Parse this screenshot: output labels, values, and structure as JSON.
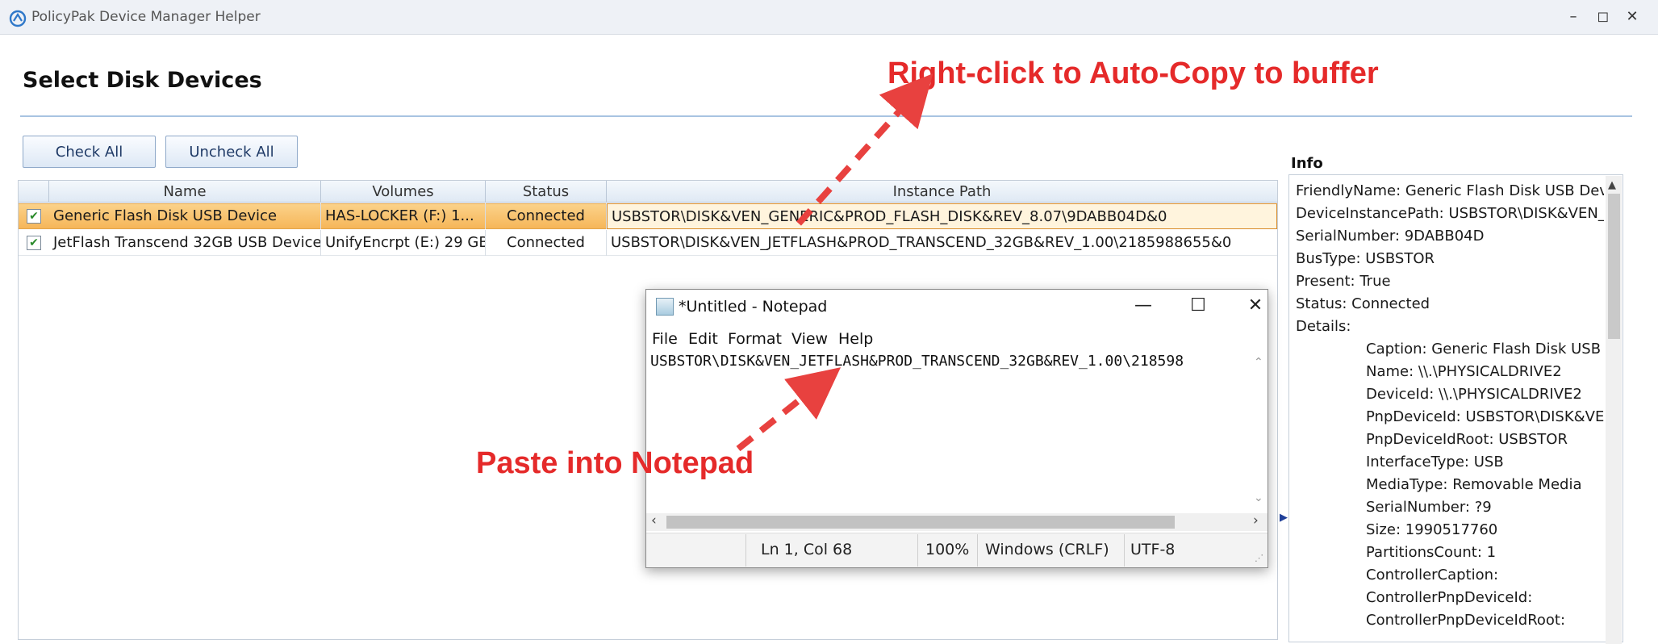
{
  "window": {
    "title": "PolicyPak Device Manager Helper",
    "minimize": "–",
    "maximize": "◻",
    "close": "✕"
  },
  "page_title": "Select Disk Devices",
  "toolbar": {
    "check_all": "Check All",
    "uncheck_all": "Uncheck All"
  },
  "grid": {
    "columns": [
      "Name",
      "Volumes",
      "Status",
      "Instance Path"
    ],
    "rows": [
      {
        "checked": true,
        "name": "Generic Flash Disk USB Device",
        "volumes": "HAS-LOCKER (F:) 1...",
        "status": "Connected",
        "path": "USBSTOR\\DISK&VEN_GENERIC&PROD_FLASH_DISK&REV_8.07\\9DABB04D&0"
      },
      {
        "checked": true,
        "name": "JetFlash Transcend 32GB USB Device",
        "volumes": "UnifyEncrpt (E:) 29 GB",
        "status": "Connected",
        "path": "USBSTOR\\DISK&VEN_JETFLASH&PROD_TRANSCEND_32GB&REV_1.00\\2185988655&0"
      }
    ]
  },
  "info": {
    "label": "Info",
    "lines": [
      "FriendlyName: Generic Flash Disk USB Devic",
      "DeviceInstancePath: USBSTOR\\DISK&VEN_G",
      "SerialNumber: 9DABB04D",
      "BusType: USBSTOR",
      "Present: True",
      "Status: Connected",
      "Details:"
    ],
    "details": [
      "Caption: Generic Flash Disk USB D",
      "Name: \\\\.\\PHYSICALDRIVE2",
      "DeviceId: \\\\.\\PHYSICALDRIVE2",
      "PnpDeviceId: USBSTOR\\DISK&VEN",
      "PnpDeviceIdRoot: USBSTOR",
      "InterfaceType: USB",
      "MediaType: Removable Media",
      "SerialNumber: ?9",
      "Size: 1990517760",
      "PartitionsCount: 1",
      "ControllerCaption:",
      "ControllerPnpDeviceId:",
      "ControllerPnpDeviceIdRoot:"
    ]
  },
  "notepad": {
    "title": "*Untitled - Notepad",
    "menu": [
      "File",
      "Edit",
      "Format",
      "View",
      "Help"
    ],
    "content": "USBSTOR\\DISK&VEN_JETFLASH&PROD_TRANSCEND_32GB&REV_1.00\\218598",
    "status": {
      "position": "Ln 1, Col 68",
      "zoom": "100%",
      "line_ending": "Windows (CRLF)",
      "encoding": "UTF-8"
    },
    "minimize": "—",
    "maximize": "☐",
    "close": "✕"
  },
  "annotations": {
    "top": "Right-click to Auto-Copy to buffer",
    "middle": "Paste into Notepad",
    "color": "#e52a2a"
  }
}
